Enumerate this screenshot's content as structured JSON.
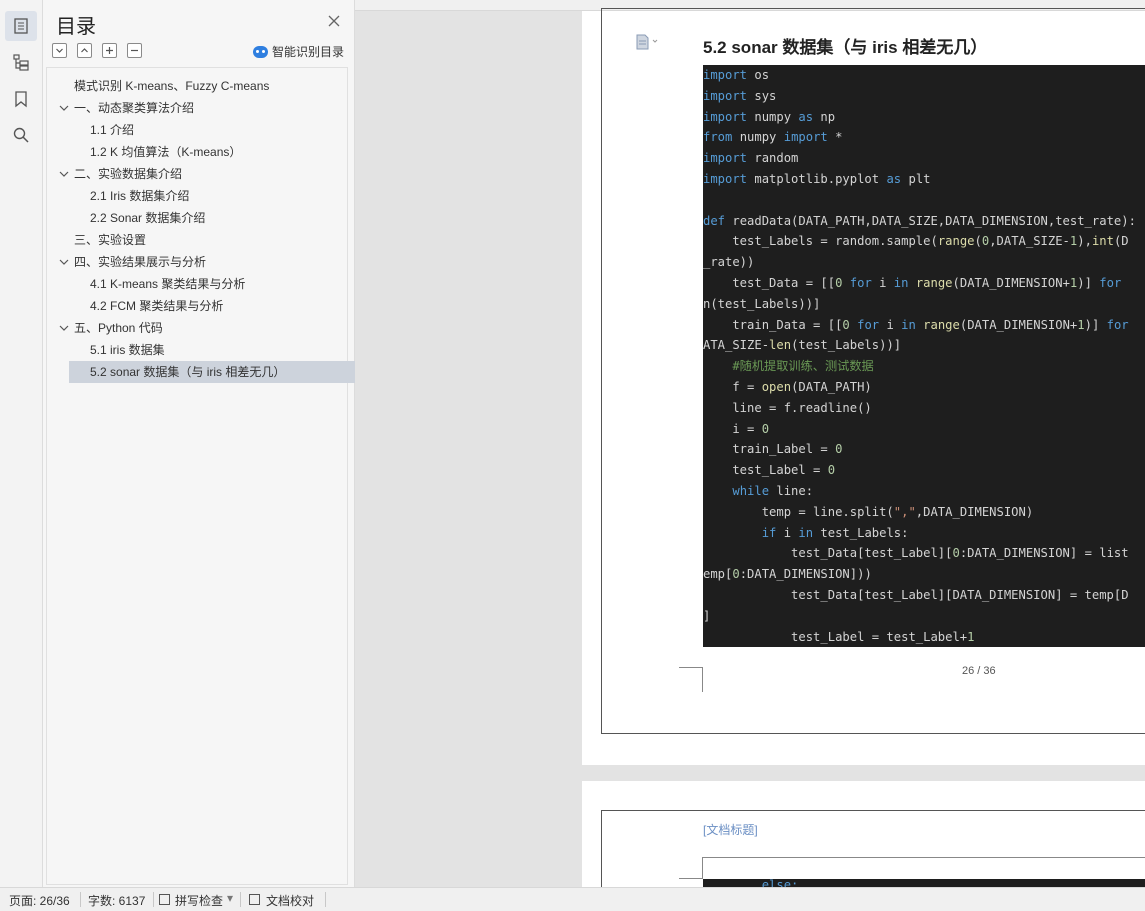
{
  "toc_panel": {
    "title": "目录",
    "smart_button_label": "智能识别目录",
    "items": [
      {
        "label": "模式识别  K-means、Fuzzy C-means",
        "level": 0,
        "expandable": false
      },
      {
        "label": "一、动态聚类算法介绍",
        "level": 1,
        "expandable": true
      },
      {
        "label": "1.1  介绍",
        "level": 2,
        "expandable": false
      },
      {
        "label": "1.2 K 均值算法（K-means）",
        "level": 2,
        "expandable": false
      },
      {
        "label": "二、实验数据集介绍",
        "level": 1,
        "expandable": true
      },
      {
        "label": "2.1 Iris 数据集介绍",
        "level": 2,
        "expandable": false
      },
      {
        "label": "2.2 Sonar 数据集介绍",
        "level": 2,
        "expandable": false
      },
      {
        "label": "三、实验设置",
        "level": 1,
        "expandable": false
      },
      {
        "label": "四、实验结果展示与分析",
        "level": 1,
        "expandable": true
      },
      {
        "label": "4.1 K-means 聚类结果与分析",
        "level": 2,
        "expandable": false
      },
      {
        "label": "4.2 FCM 聚类结果与分析",
        "level": 2,
        "expandable": false
      },
      {
        "label": "五、Python 代码",
        "level": 1,
        "expandable": true
      },
      {
        "label": "5.1 iris 数据集",
        "level": 2,
        "expandable": false
      },
      {
        "label": "5.2 sonar 数据集（与 iris 相差无几）",
        "level": 2,
        "expandable": false,
        "selected": true
      }
    ]
  },
  "document": {
    "heading": "5.2 sonar 数据集（与 iris 相差无几）",
    "code_lines": [
      "import os",
      "import sys",
      "import numpy as np",
      "from numpy import *",
      "import random",
      "import matplotlib.pyplot as plt",
      "",
      "def readData(DATA_PATH,DATA_SIZE,DATA_DIMENSION,test_rate):",
      "    test_Labels = random.sample(range(0,DATA_SIZE-1),int(D",
      "_rate))",
      "    test_Data = [[0 for i in range(DATA_DIMENSION+1)] for",
      "n(test_Labels))]",
      "    train_Data = [[0 for i in range(DATA_DIMENSION+1)] for",
      "ATA_SIZE-len(test_Labels))]",
      "    #随机提取训练、测试数据",
      "    f = open(DATA_PATH)",
      "    line = f.readline()",
      "    i = 0",
      "    train_Label = 0",
      "    test_Label = 0",
      "    while line:",
      "        temp = line.split(\",\",DATA_DIMENSION)",
      "        if i in test_Labels:",
      "            test_Data[test_Label][0:DATA_DIMENSION] = list",
      "emp[0:DATA_DIMENSION]))",
      "            test_Data[test_Label][DATA_DIMENSION] = temp[D",
      "]",
      "            test_Label = test_Label+1"
    ],
    "page_number": "26 / 36",
    "next_page_title_placeholder": "[文档标题]",
    "next_page_code": "        else:"
  },
  "status_bar": {
    "page": "页面: 26/36",
    "word_count": "字数: 6137",
    "spell_check": "拼写检查",
    "doc_proof": "文档校对"
  }
}
